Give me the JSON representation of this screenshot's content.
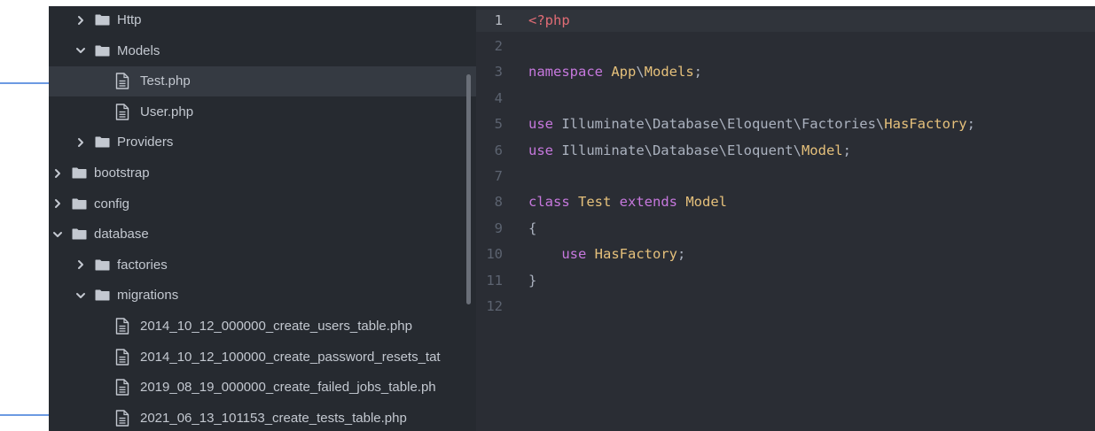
{
  "colors": {
    "sidebar_bg": "#262a30",
    "editor_bg": "#2a2d34",
    "selected_row": "#353a42",
    "folder_icon": "#c3c8d0",
    "arrow": "#3c78d8",
    "keyword_purple": "#c678dd",
    "class_yellow": "#e5c07b",
    "php_tag_red": "#e06c75",
    "plain_text": "#abb2bf"
  },
  "sidebar": {
    "items": [
      {
        "label": "Http",
        "type": "folder",
        "state": "collapsed",
        "indent": 1
      },
      {
        "label": "Models",
        "type": "folder",
        "state": "expanded",
        "indent": 1
      },
      {
        "label": "Test.php",
        "type": "file",
        "indent": 2,
        "selected": true
      },
      {
        "label": "User.php",
        "type": "file",
        "indent": 2
      },
      {
        "label": "Providers",
        "type": "folder",
        "state": "collapsed",
        "indent": 1
      },
      {
        "label": "bootstrap",
        "type": "folder",
        "state": "collapsed",
        "indent": 0
      },
      {
        "label": "config",
        "type": "folder",
        "state": "collapsed",
        "indent": 0
      },
      {
        "label": "database",
        "type": "folder",
        "state": "expanded",
        "indent": 0
      },
      {
        "label": "factories",
        "type": "folder",
        "state": "collapsed",
        "indent": 1
      },
      {
        "label": "migrations",
        "type": "folder",
        "state": "expanded",
        "indent": 1
      },
      {
        "label": "2014_10_12_000000_create_users_table.php",
        "type": "file",
        "indent": 2
      },
      {
        "label": "2014_10_12_100000_create_password_resets_tat",
        "type": "file",
        "indent": 2
      },
      {
        "label": "2019_08_19_000000_create_failed_jobs_table.ph",
        "type": "file",
        "indent": 2
      },
      {
        "label": "2021_06_13_101153_create_tests_table.php",
        "type": "file",
        "indent": 2
      }
    ]
  },
  "annotations": {
    "arrows": [
      {
        "points_to": "Test.php"
      },
      {
        "points_to": "2021_06_13_101153_create_tests_table.php"
      }
    ]
  },
  "editor": {
    "current_line": 1,
    "lines": [
      {
        "n": "1",
        "tokens": [
          {
            "t": "<?php",
            "c": "tag"
          }
        ]
      },
      {
        "n": "2",
        "tokens": []
      },
      {
        "n": "3",
        "tokens": [
          {
            "t": "namespace ",
            "c": "kw"
          },
          {
            "t": "App",
            "c": "cls"
          },
          {
            "t": "\\",
            "c": "plain"
          },
          {
            "t": "Models",
            "c": "cls"
          },
          {
            "t": ";",
            "c": "plain"
          }
        ]
      },
      {
        "n": "4",
        "tokens": []
      },
      {
        "n": "5",
        "tokens": [
          {
            "t": "use ",
            "c": "kw"
          },
          {
            "t": "Illuminate\\Database\\Eloquent\\Factories\\",
            "c": "plain"
          },
          {
            "t": "HasFactory",
            "c": "cls"
          },
          {
            "t": ";",
            "c": "plain"
          }
        ]
      },
      {
        "n": "6",
        "tokens": [
          {
            "t": "use ",
            "c": "kw"
          },
          {
            "t": "Illuminate\\Database\\Eloquent\\",
            "c": "plain"
          },
          {
            "t": "Model",
            "c": "cls"
          },
          {
            "t": ";",
            "c": "plain"
          }
        ]
      },
      {
        "n": "7",
        "tokens": []
      },
      {
        "n": "8",
        "tokens": [
          {
            "t": "class ",
            "c": "kw"
          },
          {
            "t": "Test ",
            "c": "cls"
          },
          {
            "t": "extends ",
            "c": "kw"
          },
          {
            "t": "Model",
            "c": "cls"
          }
        ]
      },
      {
        "n": "9",
        "tokens": [
          {
            "t": "{",
            "c": "plain"
          }
        ]
      },
      {
        "n": "10",
        "tokens": [
          {
            "t": "    use ",
            "c": "kw"
          },
          {
            "t": "HasFactory",
            "c": "cls"
          },
          {
            "t": ";",
            "c": "plain"
          }
        ]
      },
      {
        "n": "11",
        "tokens": [
          {
            "t": "}",
            "c": "plain"
          }
        ]
      },
      {
        "n": "12",
        "tokens": []
      }
    ]
  }
}
